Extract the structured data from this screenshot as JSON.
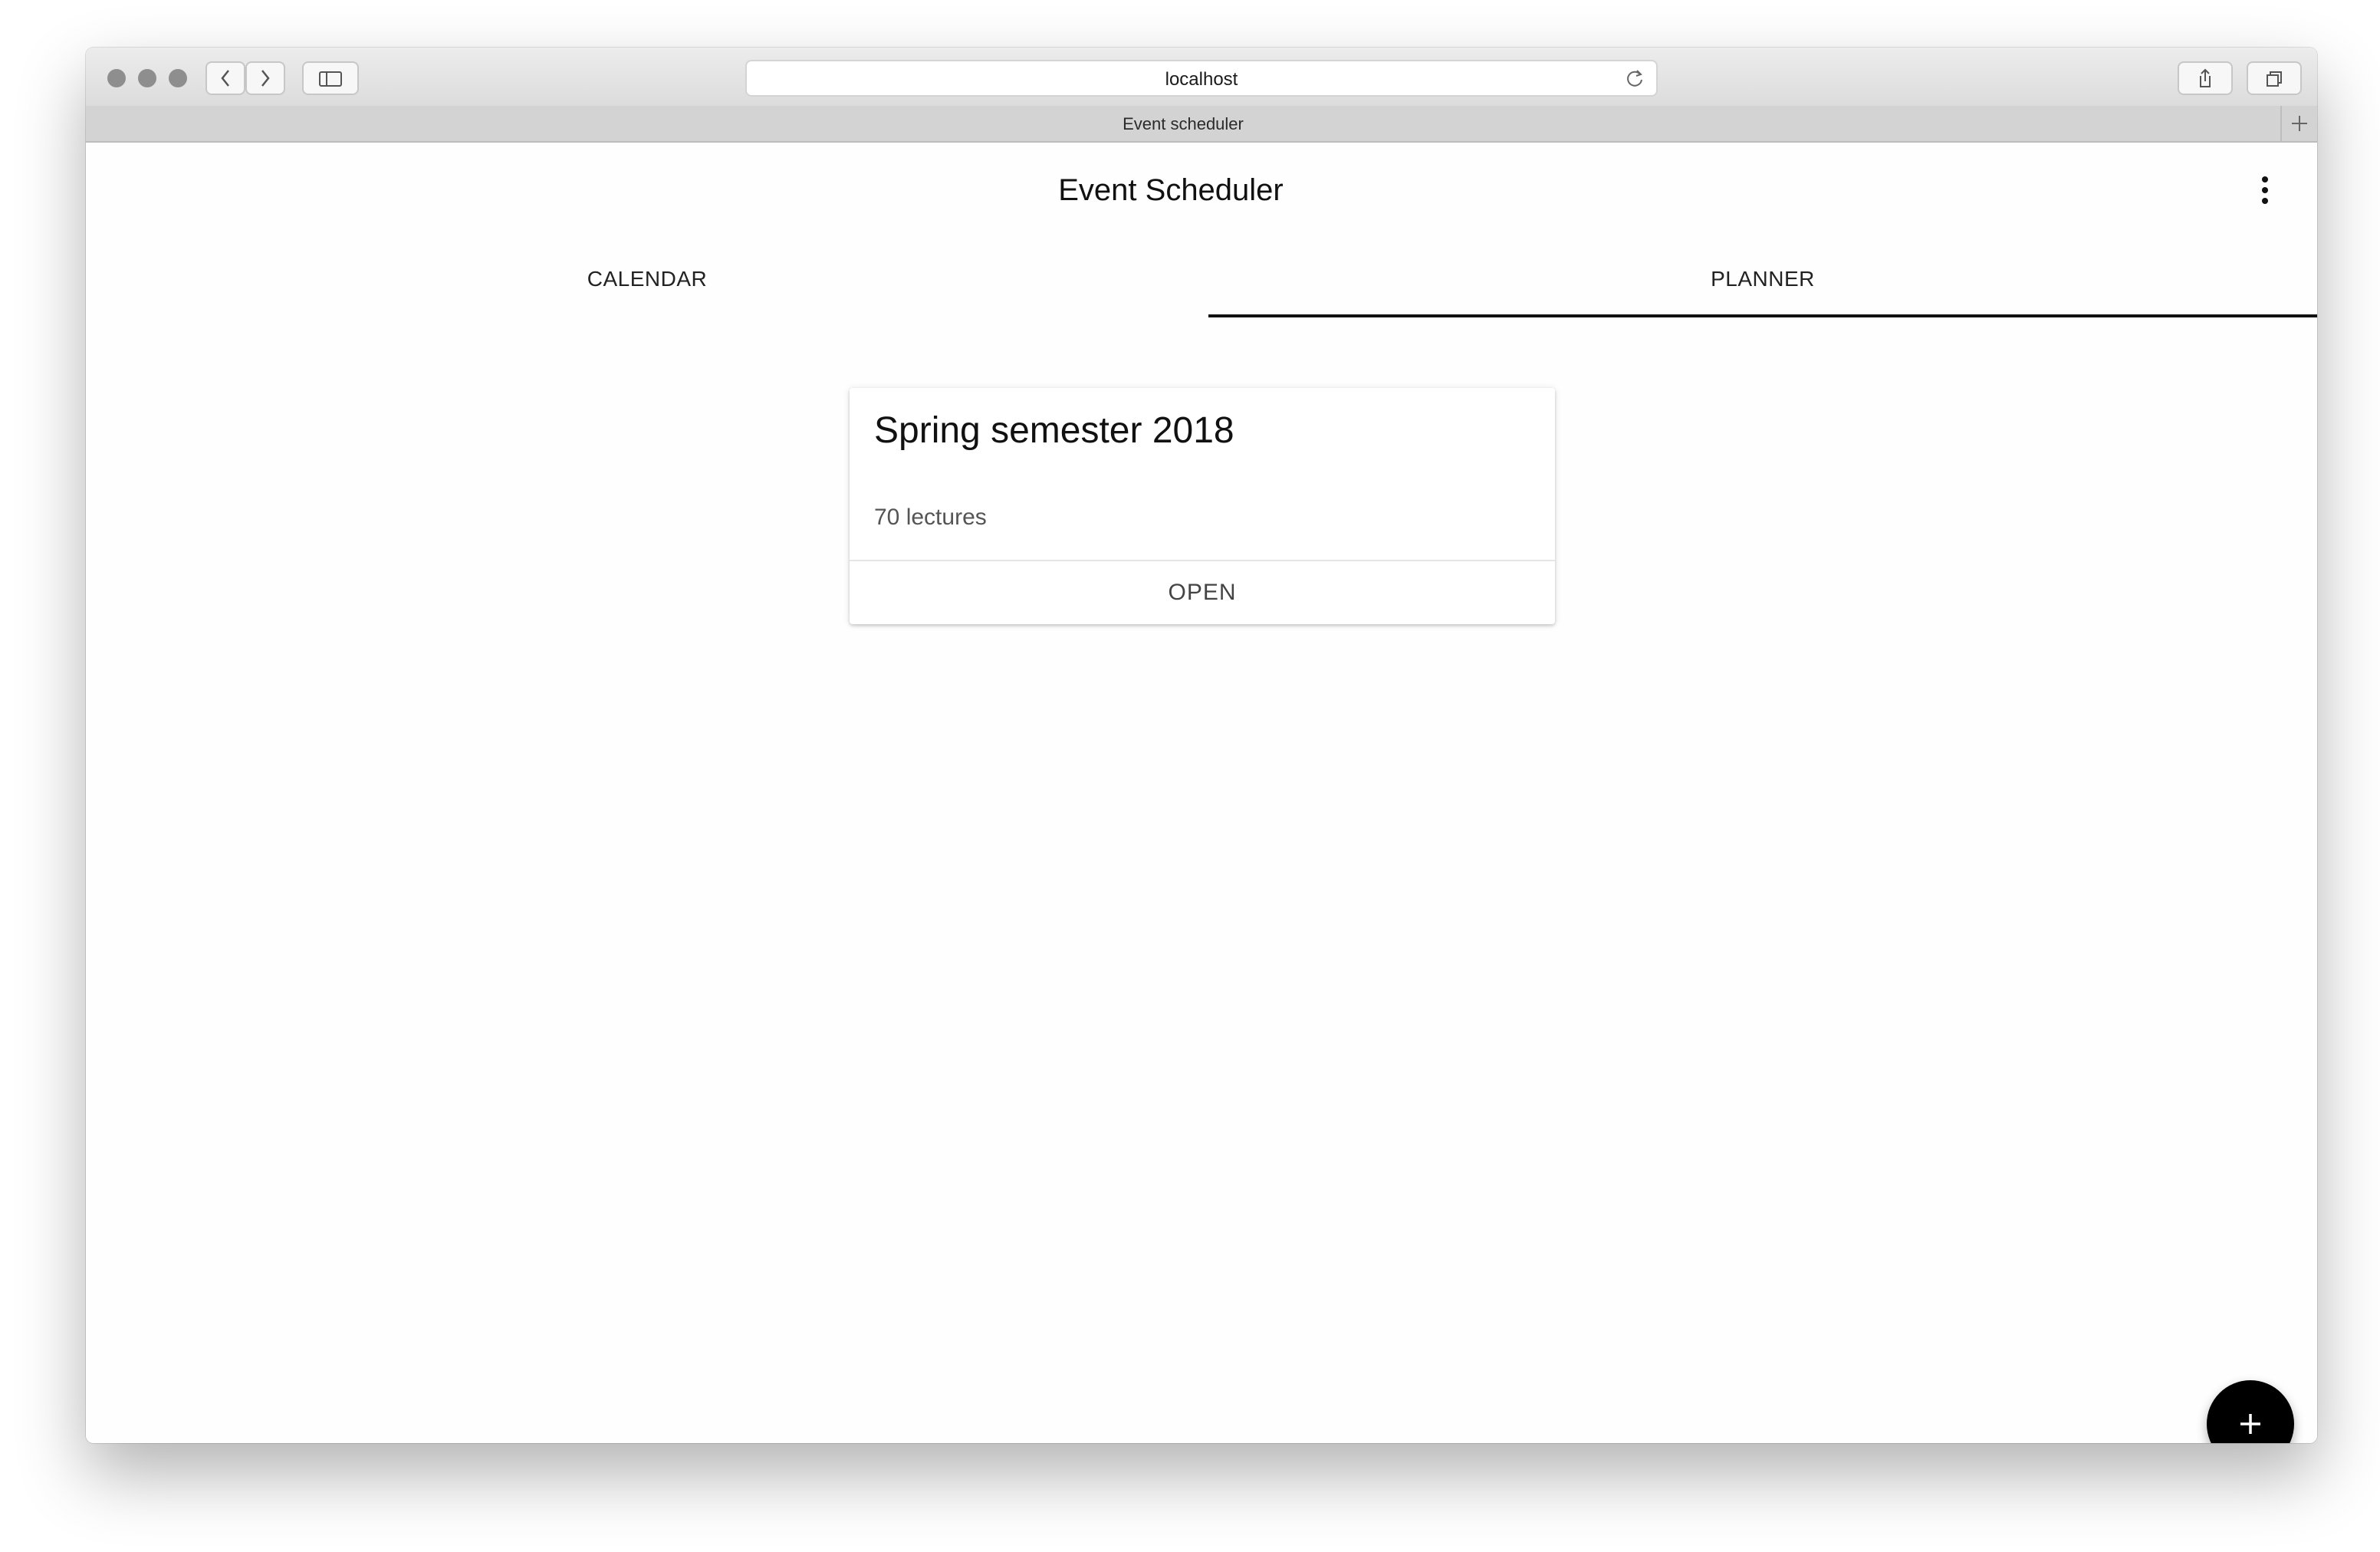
{
  "browser": {
    "url": "localhost",
    "tab_title": "Event scheduler",
    "icons": {
      "back": "chevron-left-icon",
      "forward": "chevron-right-icon",
      "sidebar": "sidebar-icon",
      "reload": "reload-icon",
      "share": "share-icon",
      "tabs": "tabs-icon",
      "new_tab": "plus-icon"
    }
  },
  "app": {
    "title": "Event Scheduler",
    "menu_icon": "more-vert-icon",
    "tabs": [
      {
        "label": "CALENDAR",
        "active": false
      },
      {
        "label": "PLANNER",
        "active": true
      }
    ],
    "cards": [
      {
        "title": "Spring semester 2018",
        "subtitle": "70 lectures",
        "action": "OPEN"
      }
    ],
    "fab_icon": "add-icon"
  },
  "colors": {
    "accent": "#111111",
    "fab": "#000000",
    "toolbar": "#e2e2e2",
    "tabbar": "#d3d3d3"
  }
}
